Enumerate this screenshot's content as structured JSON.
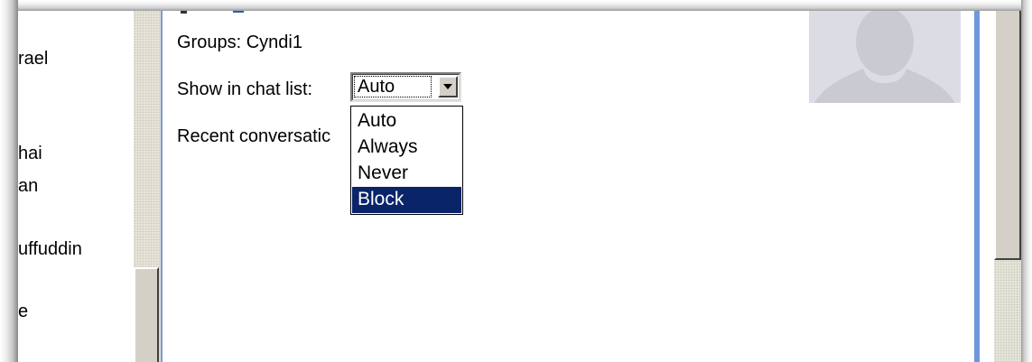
{
  "contacts": [
    {
      "label": "rael"
    },
    {
      "label": "hai"
    },
    {
      "label": "an"
    },
    {
      "label": "uffuddin"
    },
    {
      "label": "e"
    }
  ],
  "profile": {
    "groups_text": "Groups: Cyndi1",
    "show_label": "Show in chat list:",
    "recent_label": "Recent conversatic"
  },
  "chat_list_select": {
    "selected_value": "Auto",
    "options": [
      "Auto",
      "Always",
      "Never",
      "Block"
    ],
    "highlighted_option": "Block"
  },
  "colors": {
    "selection_bg": "#0a246a",
    "panel_border": "#6f97dc",
    "avatar_bg": "#dcdde4",
    "avatar_silhouette": "#c8c9d1"
  },
  "icons": {
    "avatar": "person-silhouette-icon",
    "dropdown_arrow": "chevron-down-icon"
  }
}
